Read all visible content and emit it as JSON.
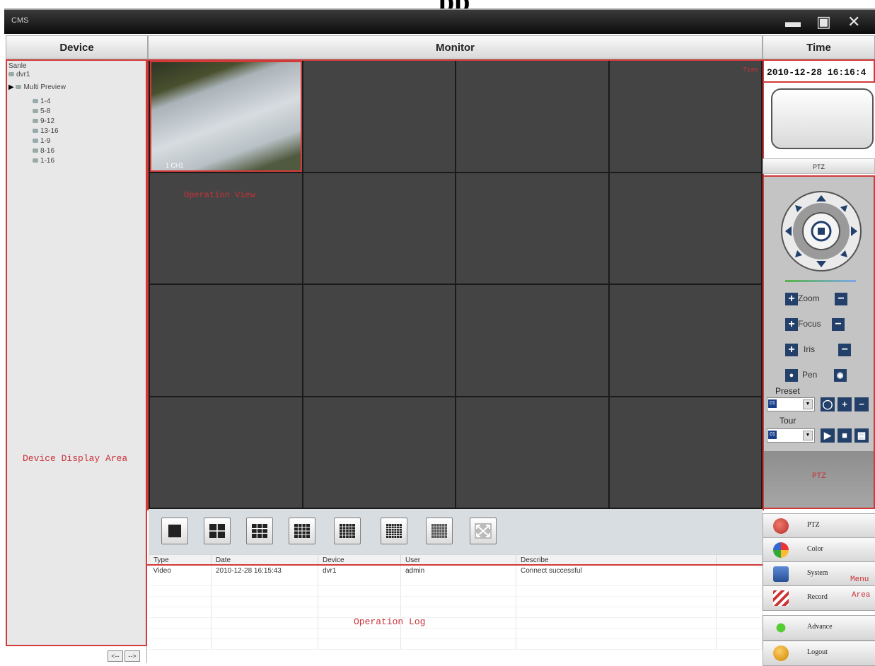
{
  "page_heading": "pp",
  "window": {
    "app_title": "CMS",
    "minimize": "▬",
    "restore": "▣",
    "close": "✕"
  },
  "headers": {
    "device": "Device",
    "monitor": "Monitor",
    "time": "Time"
  },
  "tree": {
    "root": "Sanle",
    "device": "dvr1",
    "group": "Multi Preview",
    "items": [
      "1-4",
      "5-8",
      "9-12",
      "13-16",
      "1-9",
      "8-16",
      "1-16"
    ],
    "area_label": "Device Display Area",
    "nav_prev": "<--",
    "nav_next": "-->"
  },
  "monitor": {
    "area_label": "Operation View",
    "stamp": "1 CH1",
    "inline_label": "Time"
  },
  "time_display": "2010-12-28 16:16:4",
  "ptz": {
    "header": "PTZ",
    "zoom": "Zoom",
    "focus": "Focus",
    "iris": "Iris",
    "pen": "Pen",
    "preset": "Preset",
    "tour": "Tour",
    "preset_value": "01",
    "tour_value": "01",
    "area_label": "PTZ"
  },
  "log": {
    "columns": [
      "Type",
      "Date",
      "Device",
      "User",
      "Describe"
    ],
    "rows": [
      [
        "Video",
        "2010-12-28 16:15:43",
        "dvr1",
        "admin",
        "Connect successful"
      ]
    ],
    "area_label": "Operation Log"
  },
  "menu": {
    "items": [
      "PTZ",
      "Color",
      "System",
      "Record",
      "Advance",
      "Logout"
    ],
    "area_label_line1": "Menu",
    "area_label_line2": "Area"
  }
}
